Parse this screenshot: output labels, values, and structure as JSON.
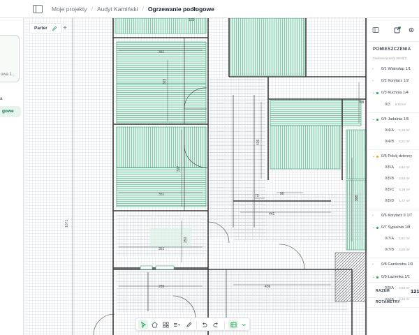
{
  "header": {
    "breadcrumbs": [
      "Moje projekty",
      "Audyt Kamiński",
      "Ogrzewanie podłogowe"
    ]
  },
  "left_panel": {
    "card_caption": "owa 1...",
    "item_1": "a",
    "active_item": "gowe"
  },
  "floor_tab": {
    "label": "Parter",
    "add": "+"
  },
  "plan": {
    "dims": [
      "123",
      "351",
      "323",
      "327",
      "351",
      "351",
      "350",
      "289",
      "436",
      "436",
      "441",
      "70",
      "90",
      "708",
      "908",
      "1071"
    ],
    "tags": [
      "",
      ""
    ]
  },
  "right_panel": {
    "title": "POMIESZCZENIA",
    "subtitle": "Zasilanie/powrót 35/30°C",
    "rooms": [
      {
        "name": "0/1 Wiatrołap 1/1",
        "dot": ""
      },
      {
        "name": "0/2 Korytarz 1/2",
        "dot": ""
      },
      {
        "name": "0/3 Kuchnia 1/4",
        "dot": "#16a34a",
        "subs": [
          {
            "name": "0/3",
            "area": "6,93 m²"
          }
        ]
      },
      {
        "name": "0/4 Jadalnia 1/5",
        "dot": "#16a34a",
        "subs": [
          {
            "name": "0/4/A",
            "area": "5,18 m²"
          },
          {
            "name": "0/4/B",
            "area": "6,21 m²"
          }
        ]
      },
      {
        "name": "0/5 Pokój dzienny",
        "dot": "#f59e0b",
        "subs": [
          {
            "name": "0/5/A",
            "area": "4,62 m²"
          },
          {
            "name": "0/5/B",
            "area": "3,93 m²"
          },
          {
            "name": "0/5/C",
            "area": "5,26 m²"
          },
          {
            "name": "0/5/D",
            "area": "1,47 m²"
          }
        ]
      },
      {
        "name": "0/6 Korytarz II 1/7",
        "dot": ""
      },
      {
        "name": "0/7 Sypialnia 1/8",
        "dot": "#16a34a",
        "subs": [
          {
            "name": "0/7/A",
            "area": "5,81 m²"
          },
          {
            "name": "0/7/B",
            "area": "3,69 m²"
          }
        ]
      },
      {
        "name": "0/8 Garderoba 1/9",
        "dot": ""
      },
      {
        "name": "0/9 Łazienka 1/1",
        "dot": "#16a34a",
        "subs": [
          {
            "name": "0/9/A",
            "area": "3,50 m²"
          },
          {
            "name": "0/9/B",
            "area": "3,46 m²"
          }
        ]
      }
    ],
    "total_label": "RAZEM",
    "total_value": "121",
    "rotameters_label": "ROTAMETRY"
  },
  "toolbar": {
    "tools": [
      "select-tool",
      "polygon-tool",
      "grid-tool",
      "layers-tool",
      "draw-tool",
      "undo",
      "redo",
      "table-tool"
    ]
  },
  "colors": {
    "accent": "#16a34a",
    "heating_pipe": "#2f9e73",
    "wall": "#3a3a3a",
    "grid": "#eef0f2",
    "zone_fill": "#dff2ea"
  }
}
